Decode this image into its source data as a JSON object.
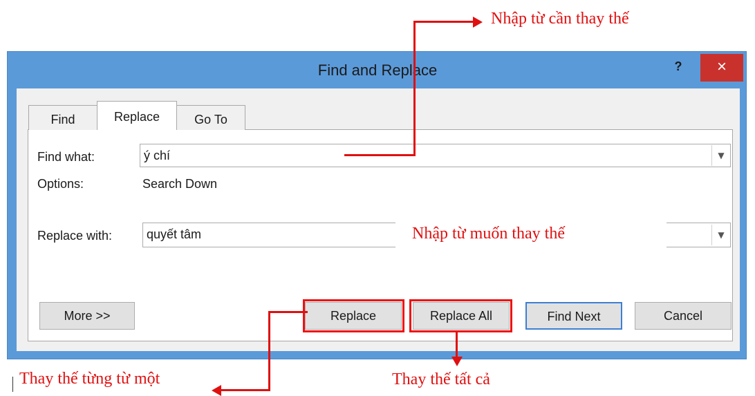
{
  "dialog": {
    "title": "Find and Replace",
    "help": "?",
    "close": "×",
    "tabs": [
      "Find",
      "Replace",
      "Go To"
    ],
    "active_tab": "Replace"
  },
  "find": {
    "label": "Find what:",
    "value": "ý chí"
  },
  "options": {
    "label": "Options:",
    "value": "Search Down"
  },
  "replace": {
    "label": "Replace with:",
    "value": "quyết tâm"
  },
  "buttons": {
    "more": "More >>",
    "replace": "Replace",
    "replace_all": "Replace All",
    "find_next": "Find Next",
    "cancel": "Cancel"
  },
  "annotations": {
    "find_hint": "Nhập từ cần thay thế",
    "replace_hint": "Nhập từ muốn thay thế",
    "replace_one": "Thay thế từng từ một",
    "replace_all": "Thay thế tất cả"
  },
  "colors": {
    "titlebar": "#5b9ad9",
    "close": "#c9322c",
    "annotation": "#e01010",
    "focus": "#3c7fd3"
  }
}
